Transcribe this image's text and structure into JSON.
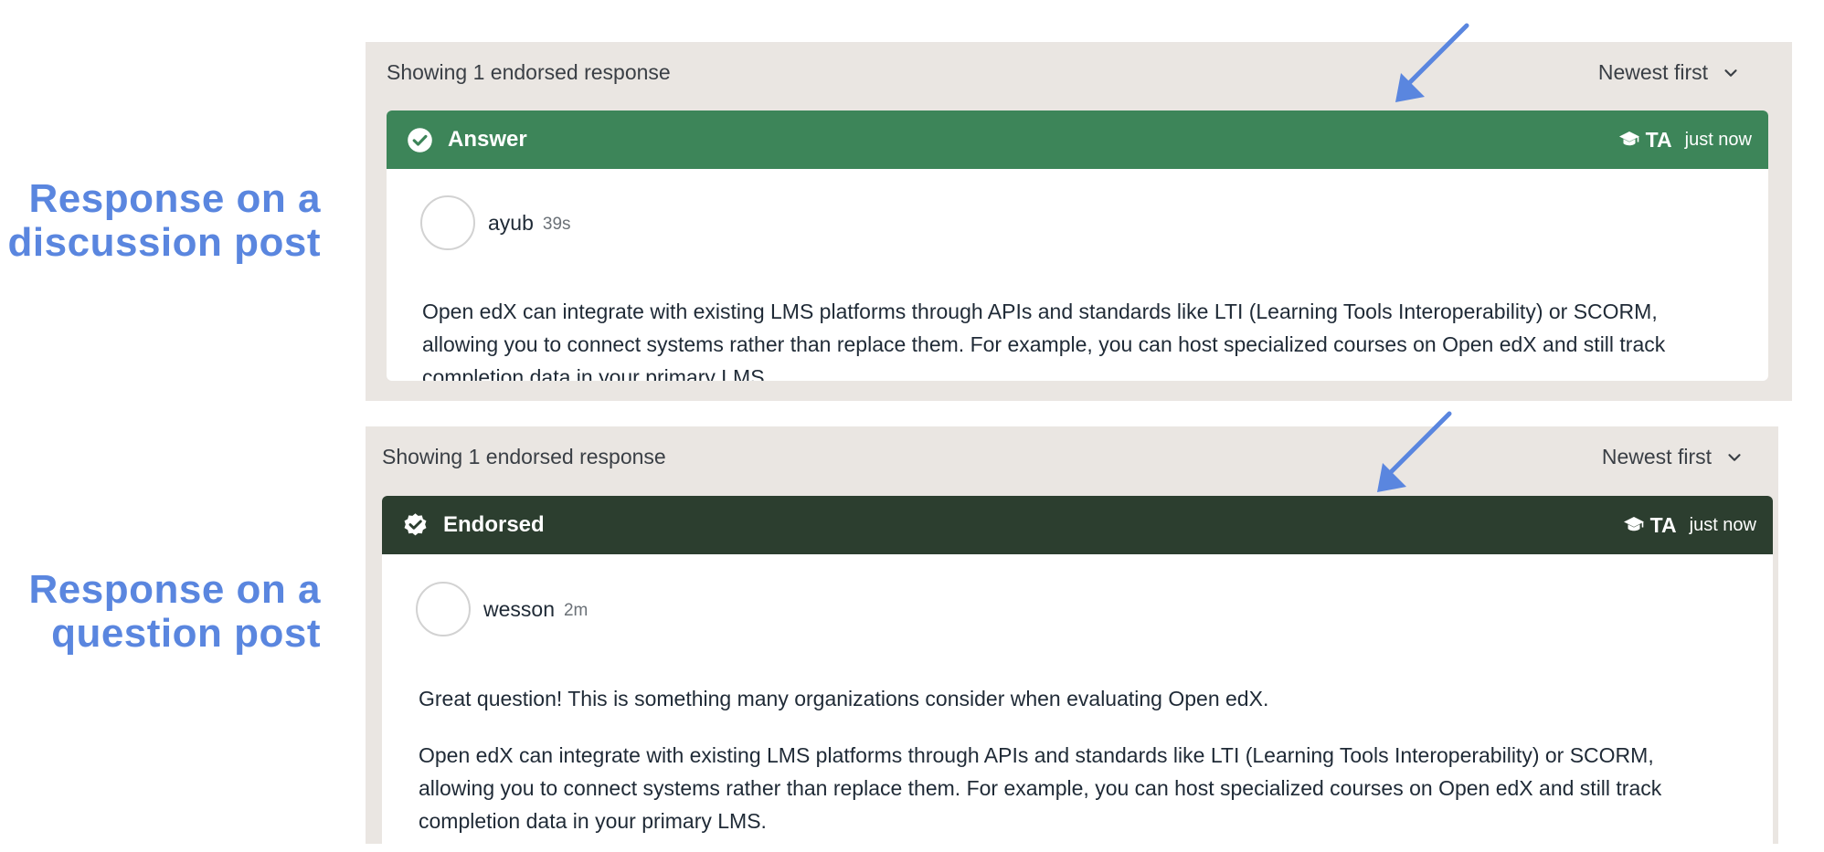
{
  "labels": {
    "discussion": [
      "Response on a",
      "discussion post"
    ],
    "question": [
      "Response on a",
      "question post"
    ]
  },
  "colors": {
    "label": "#5a86df",
    "arrow": "#5a86df",
    "answer_banner": "#3d8559",
    "endorsed_banner": "#2c3e2f",
    "panel_bg": "#eae6e2"
  },
  "discussion_panel": {
    "showing": "Showing 1 endorsed response",
    "sort": "Newest first",
    "banner": {
      "icon": "check-circle-icon",
      "title": "Answer",
      "role_icon": "graduation-cap-icon",
      "role": "TA",
      "time": "just now"
    },
    "author": "ayub",
    "time": "39s",
    "body": "Open edX can integrate with existing LMS platforms through APIs and standards like LTI (Learning Tools Interoperability) or SCORM, allowing you to connect systems rather than replace them. For example, you can host specialized courses on Open edX and still track completion data in your primary LMS."
  },
  "question_panel": {
    "showing": "Showing 1 endorsed response",
    "sort": "Newest first",
    "banner": {
      "icon": "verified-badge-icon",
      "title": "Endorsed",
      "role_icon": "graduation-cap-icon",
      "role": "TA",
      "time": "just now"
    },
    "author": "wesson",
    "time": "2m",
    "body_p1": "Great question! This is something many organizations consider when evaluating Open edX.",
    "body_p2": "Open edX can integrate with existing LMS platforms through APIs and standards like LTI (Learning Tools Interoperability) or SCORM, allowing you to connect systems rather than replace them. For example, you can host specialized courses on Open edX and still track completion data in your primary LMS."
  }
}
